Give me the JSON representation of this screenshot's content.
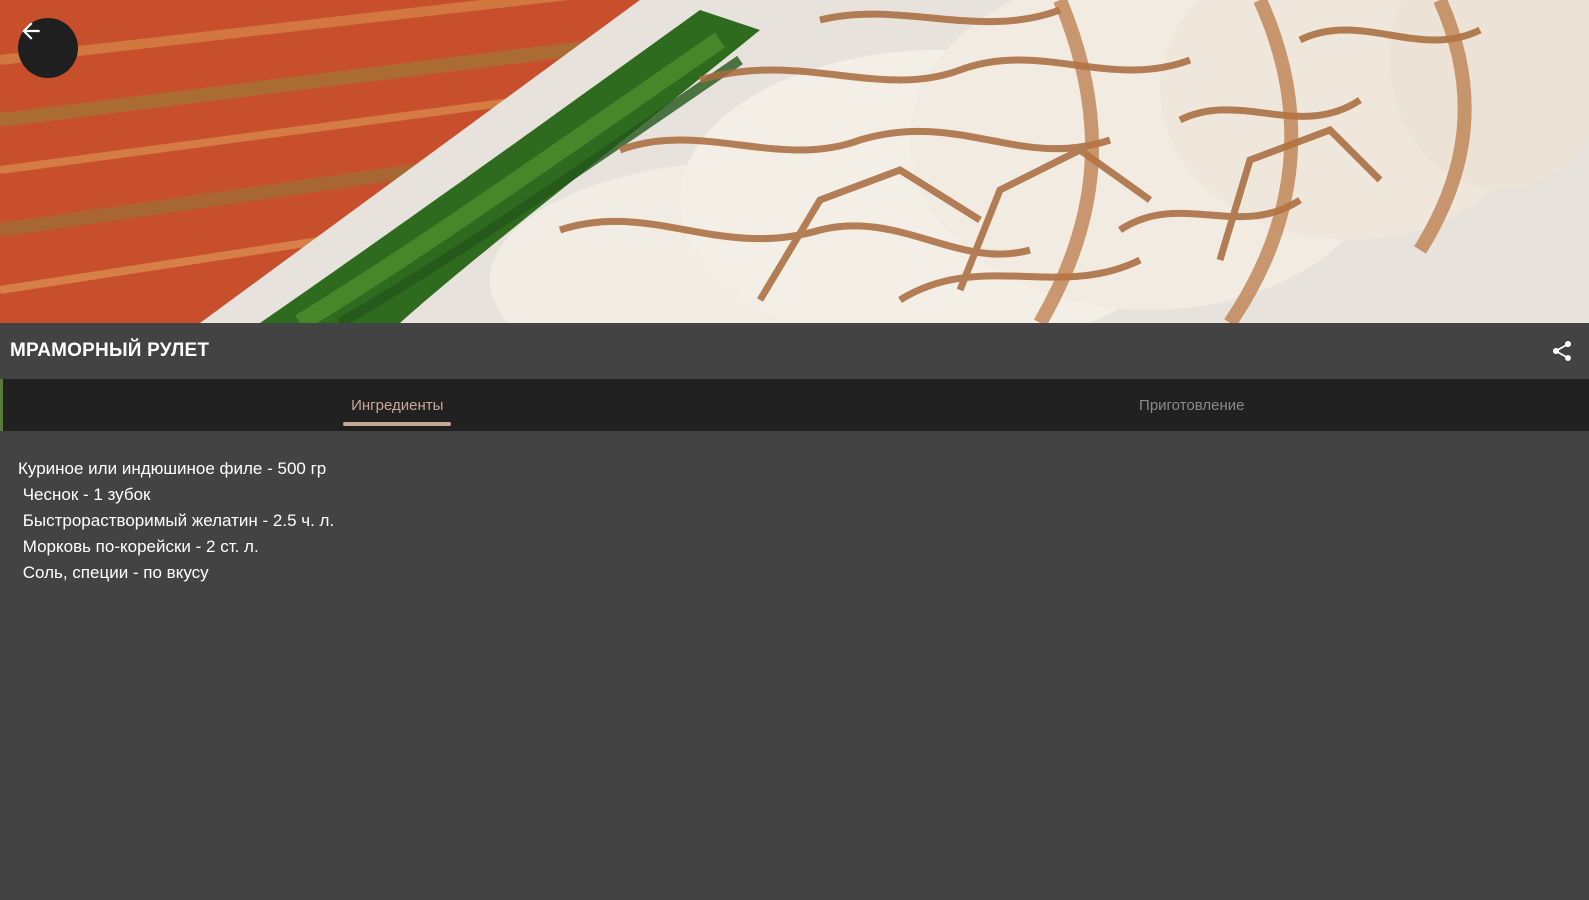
{
  "hero": {
    "image_alt": "Мраморный рулет"
  },
  "header": {
    "title": "МРАМОРНЫЙ РУЛЕТ",
    "back_icon": "arrow-left-icon",
    "share_icon": "share-icon"
  },
  "tabs": [
    {
      "label": "Ингредиенты",
      "active": true
    },
    {
      "label": "Приготовление",
      "active": false
    }
  ],
  "ingredients": [
    "Куриное или индюшиное филе - 500 гр",
    " Чеснок - 1 зубок",
    " Быстрорастворимый желатин - 2.5 ч. л.",
    " Морковь по-корейски - 2 ст. л.",
    " Соль, специи - по вкусу"
  ],
  "colors": {
    "background": "#424242",
    "tab_bar": "#212121",
    "accent": "#c7a896",
    "text": "#ffffff"
  }
}
